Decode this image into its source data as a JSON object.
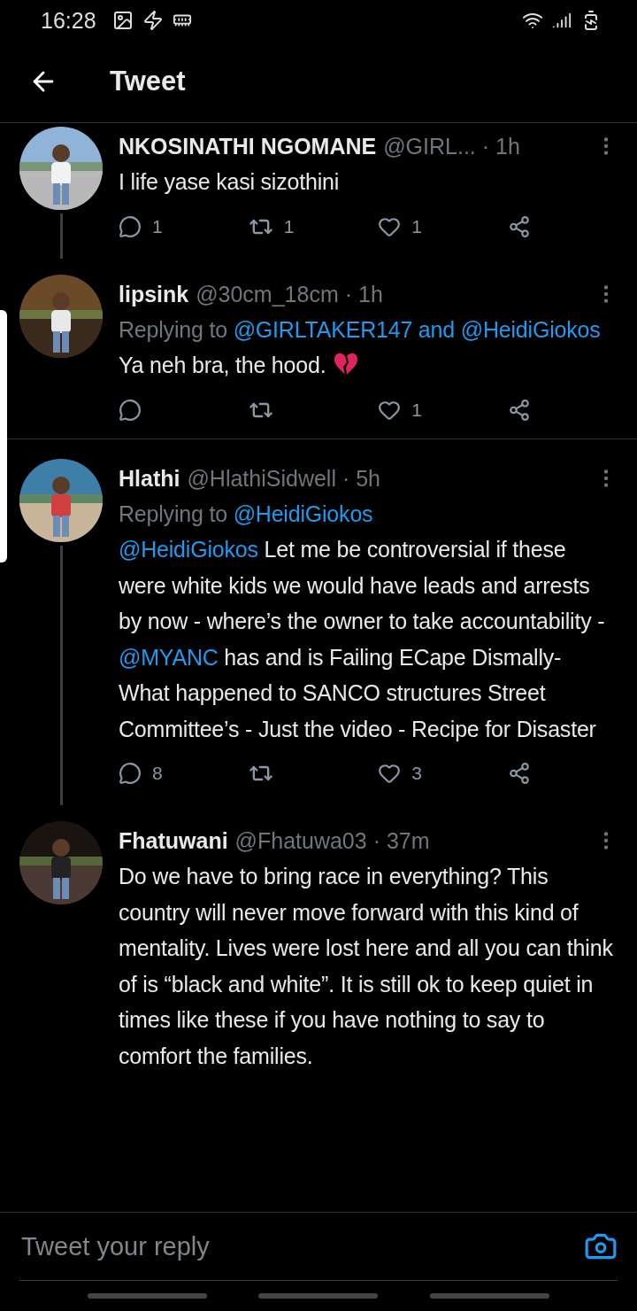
{
  "status_bar": {
    "time": "16:28"
  },
  "header": {
    "title": "Tweet"
  },
  "tweets": [
    {
      "name": "NKOSINATHI NGOMANE",
      "handle": "@GIRL...",
      "time": "· 1h",
      "body": [
        {
          "text": "I life yase kasi sizothini",
          "link": false
        }
      ],
      "counts": {
        "reply": "1",
        "retweet": "1",
        "like": "1"
      },
      "thread_line_below": true
    },
    {
      "name": "lipsink",
      "handle": "@30cm_18cm",
      "time": "· 1h",
      "reply_to": [
        {
          "text": "Replying to",
          "link": false
        },
        {
          "text": "@GIRLTAKER147",
          "link": true
        },
        {
          "text": "and",
          "link": true
        },
        {
          "text": "@HeidiGiokos",
          "link": true
        }
      ],
      "body": [
        {
          "text": "Ya neh bra, the hood.",
          "link": false
        }
      ],
      "emoji": true,
      "counts": {
        "like": "1"
      },
      "divider_below": true
    },
    {
      "name": "Hlathi",
      "handle": "@HlathiSidwell",
      "time": "· 5h",
      "reply_to": [
        {
          "text": "Replying to",
          "link": false
        },
        {
          "text": "@HeidiGiokos",
          "link": true
        }
      ],
      "body": [
        {
          "text": "@HeidiGiokos",
          "link": true
        },
        {
          "text": "Let me be controversial if these were white kids we would have leads and arrests by now - where’s the owner to take accountability -",
          "link": false
        },
        {
          "text": "@MYANC",
          "link": true
        },
        {
          "text": "has and is Failing ECape Dismally- What happened to SANCO structures Street Committee’s - Just the video - Recipe for Disaster",
          "link": false
        }
      ],
      "counts": {
        "reply": "8",
        "like": "3"
      },
      "thread_line_below": true
    },
    {
      "name": "Fhatuwani",
      "handle": "@Fhatuwa03",
      "time": "· 37m",
      "body": [
        {
          "text": "Do we have to bring race in everything? This country will never move forward with this kind of mentality. Lives were lost here and all you can think of is “black and white”. It is still ok to keep quiet in times like these if you have nothing to say to comfort the families.",
          "link": false
        }
      ]
    }
  ],
  "reply_bar": {
    "placeholder": "Tweet your reply"
  }
}
